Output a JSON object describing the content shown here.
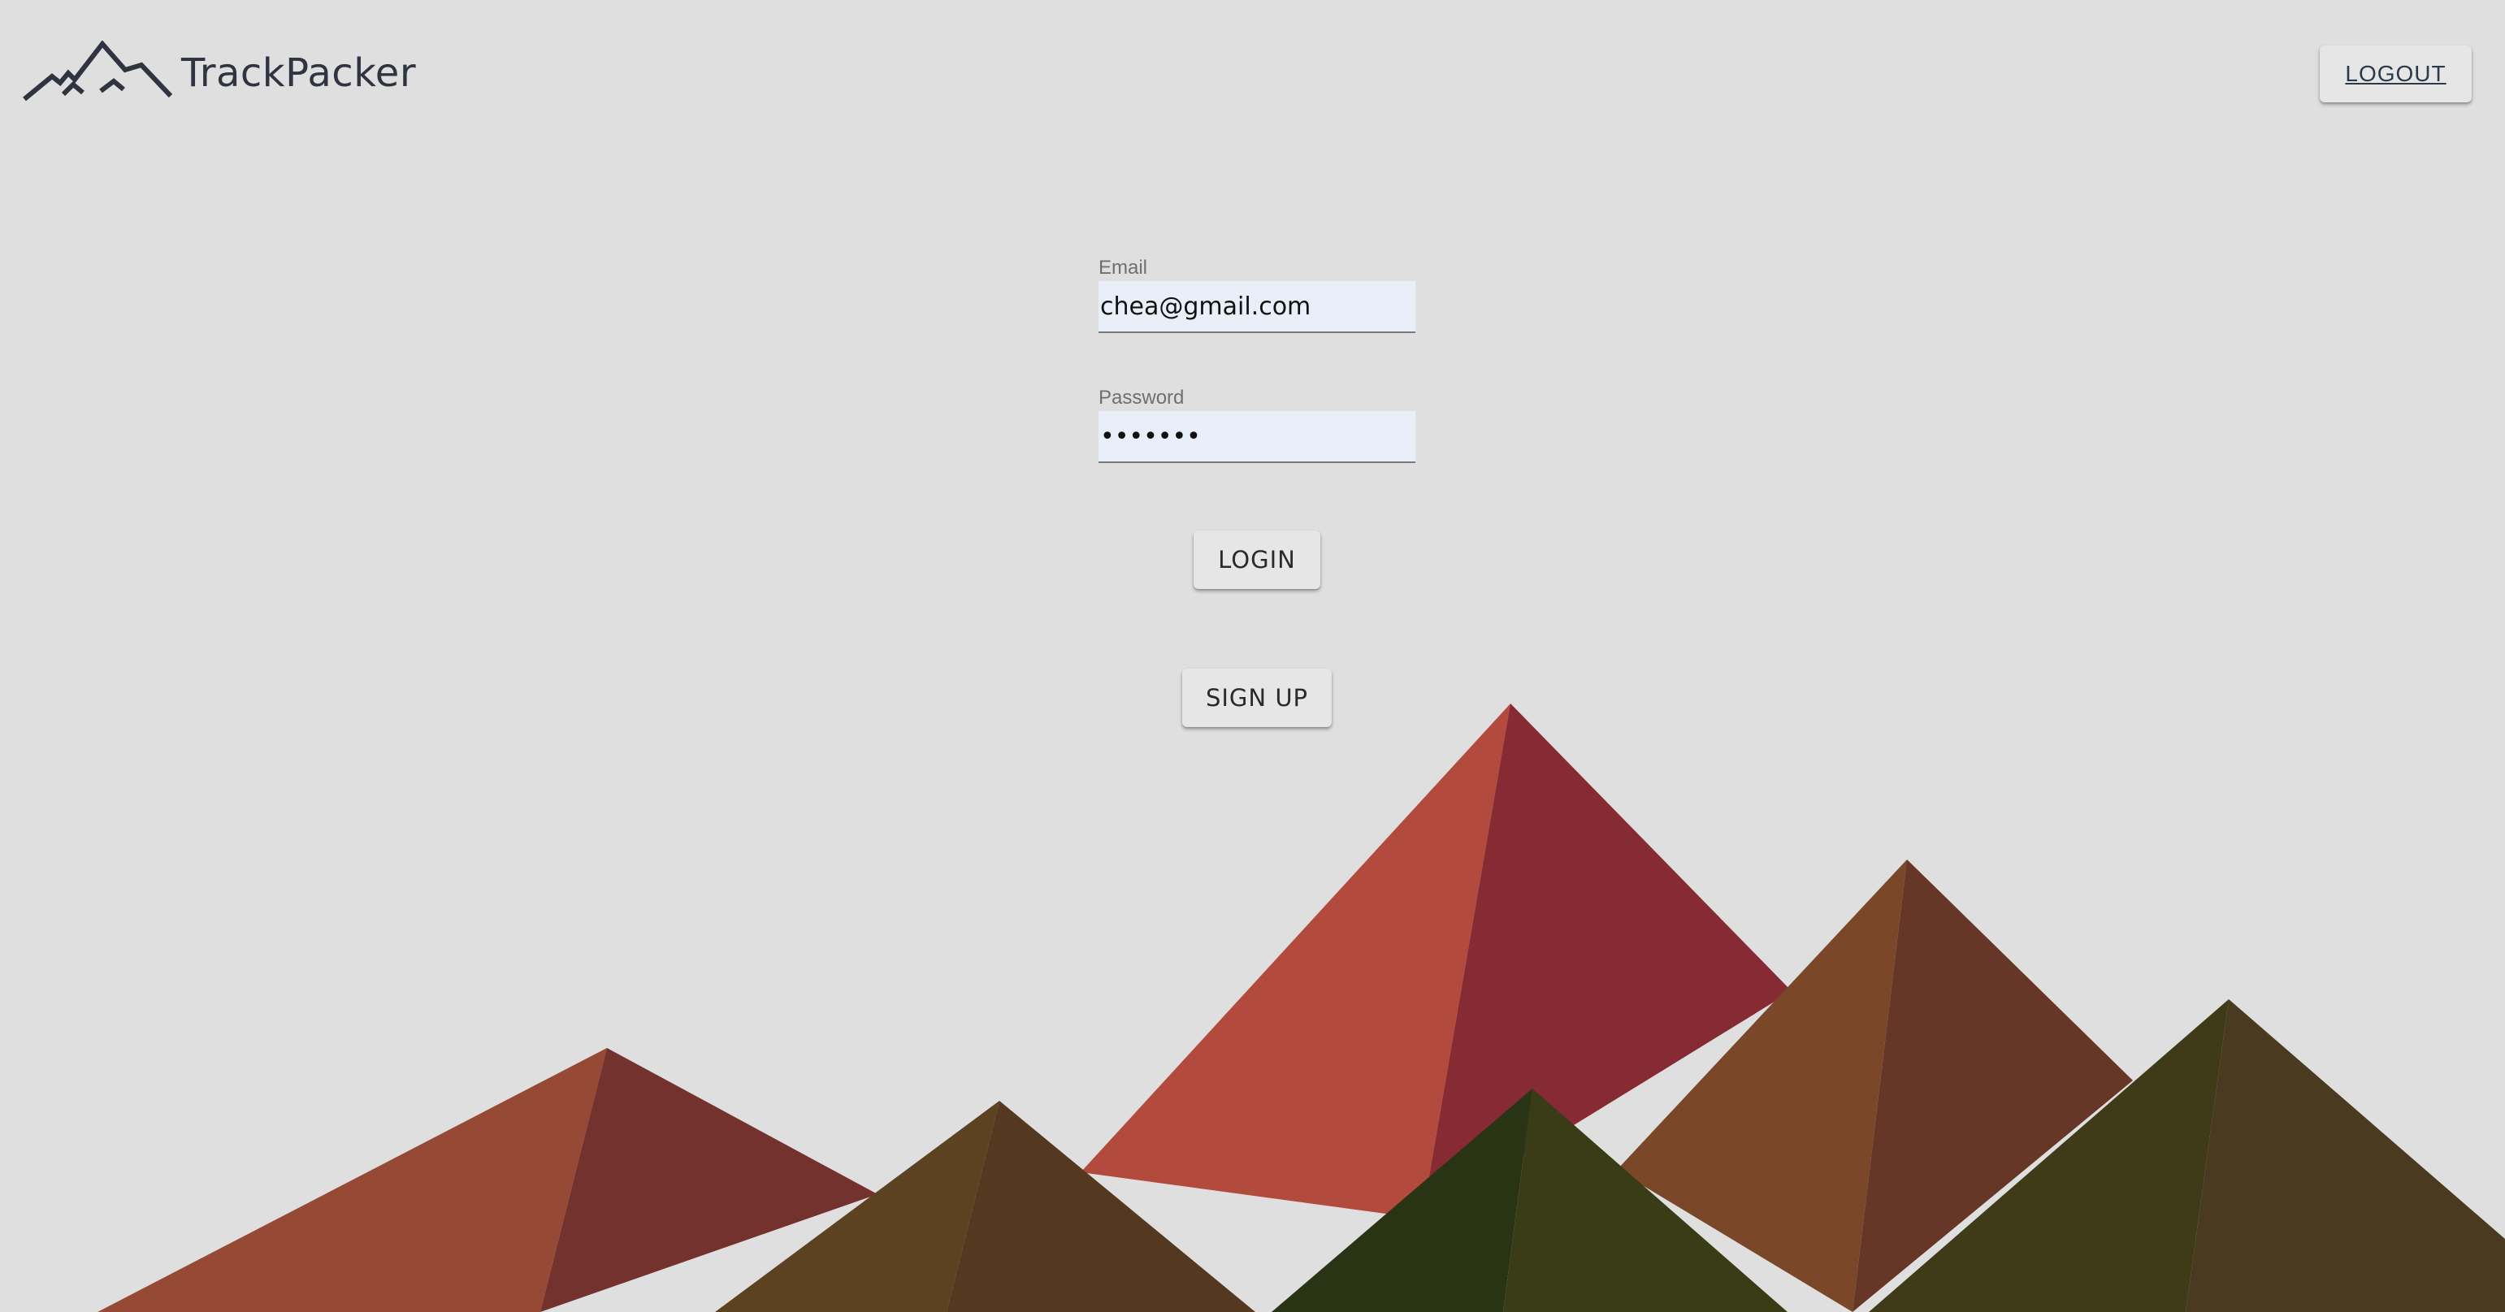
{
  "header": {
    "app_title": "TrackPacker",
    "logo_icon": "mountain-logo-icon",
    "logout_label": "LOGOUT"
  },
  "form": {
    "email": {
      "label": "Email",
      "value": "chea@gmail.com",
      "type": "email"
    },
    "password": {
      "label": "Password",
      "value": "•••••••",
      "type": "password"
    },
    "login_label": "LOGIN",
    "signup_label": "SIGN UP"
  },
  "theme": {
    "background": "#dfdfdf",
    "input_background": "#e8eff9",
    "brand_text": "#2f3440",
    "mountain_colors": [
      "#b34a3e",
      "#862b33",
      "#964a35",
      "#74322f",
      "#7a4829",
      "#663626",
      "#5d4221",
      "#553820",
      "#283414",
      "#3a3b17",
      "#3f3a18",
      "#4a3a20"
    ]
  }
}
